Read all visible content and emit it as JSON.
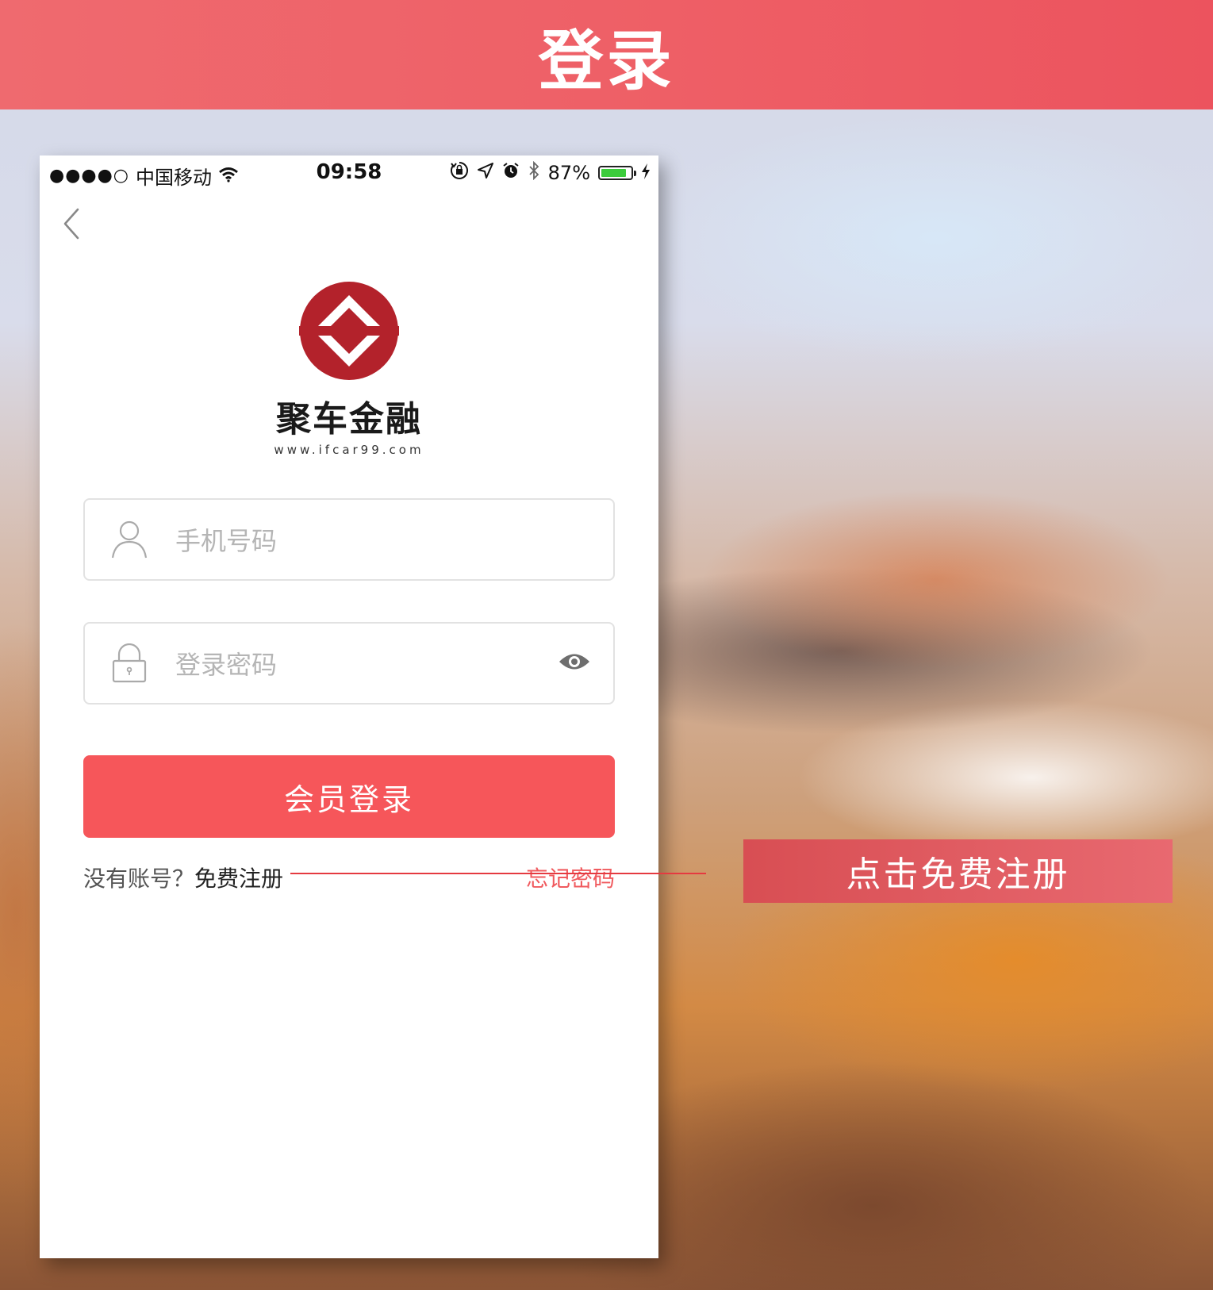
{
  "header": {
    "title": "登录"
  },
  "status_bar": {
    "signal": "●●●●○",
    "carrier": "中国移动",
    "time": "09:58",
    "battery_percent": "87%",
    "battery_level": 0.87,
    "battery_color": "#3ccc3c"
  },
  "brand": {
    "name": "聚车金融",
    "url": "www.ifcar99.com",
    "logo_color": "#b3222b"
  },
  "form": {
    "phone_placeholder": "手机号码",
    "password_placeholder": "登录密码",
    "login_button": "会员登录"
  },
  "links": {
    "no_account": "没有账号？",
    "register": "免费注册",
    "forgot_password": "忘记密码"
  },
  "annotation": {
    "callout": "点击免费注册"
  },
  "colors": {
    "accent": "#f6565a",
    "header": "#ee5f66",
    "forgot_link": "#f05a5e"
  },
  "icons": [
    "back-chevron-icon",
    "user-icon",
    "lock-icon",
    "eye-icon",
    "wifi-icon",
    "rotation-lock-icon",
    "location-arrow-icon",
    "alarm-icon",
    "bluetooth-icon",
    "charging-bolt-icon"
  ]
}
